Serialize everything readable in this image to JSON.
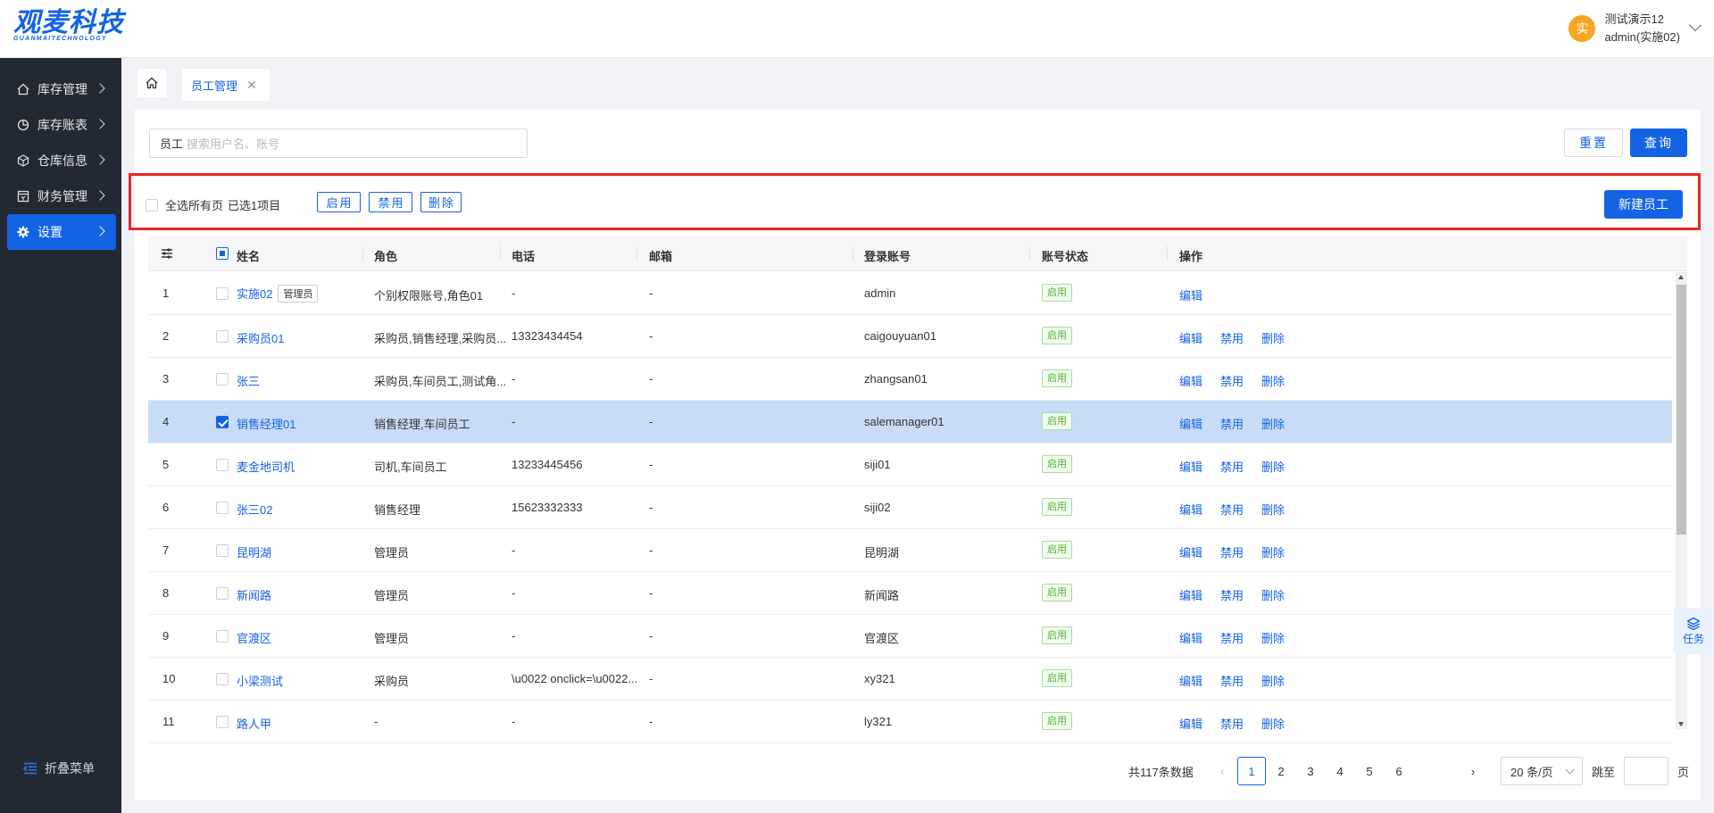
{
  "header": {
    "logo_main": "观麦科技",
    "logo_sub": "GUANMAITECHNOLOGY",
    "avatar_text": "实",
    "user_line1": "测试演示12",
    "user_line2": "admin(实施02)"
  },
  "sidebar": {
    "items": [
      {
        "label": "库存管理",
        "icon": "home-icon"
      },
      {
        "label": "库存账表",
        "icon": "pie-chart-icon"
      },
      {
        "label": "仓库信息",
        "icon": "cube-icon"
      },
      {
        "label": "财务管理",
        "icon": "finance-icon"
      },
      {
        "label": "设置",
        "icon": "gear-icon",
        "active": true
      }
    ],
    "collapse_label": "折叠菜单"
  },
  "tabs": {
    "active_label": "员工管理"
  },
  "search": {
    "label": "员工",
    "placeholder": "搜索用户名、账号",
    "reset_label": "重置",
    "query_label": "查询"
  },
  "actions": {
    "select_all_label": "全选所有页",
    "selected_text": "已选1项目",
    "enable_label": "启用",
    "disable_label": "禁用",
    "delete_label": "删除",
    "new_label": "新建员工"
  },
  "table": {
    "columns": [
      "姓名",
      "角色",
      "电话",
      "邮箱",
      "登录账号",
      "账号状态",
      "操作"
    ],
    "rows": [
      {
        "no": "1",
        "name": "实施02",
        "tag": "管理员",
        "role": "个别权限账号,角色01",
        "phone": "-",
        "email": "-",
        "account": "admin",
        "status": "启用",
        "checked": false,
        "ops": [
          "编辑"
        ]
      },
      {
        "no": "2",
        "name": "采购员01",
        "tag": "",
        "role": "采购员,销售经理,采购员...",
        "phone": "13323434454",
        "email": "-",
        "account": "caigouyuan01",
        "status": "启用",
        "checked": false,
        "ops": [
          "编辑",
          "禁用",
          "删除"
        ]
      },
      {
        "no": "3",
        "name": "张三",
        "tag": "",
        "role": "采购员,车间员工,测试角...",
        "phone": "-",
        "email": "-",
        "account": "zhangsan01",
        "status": "启用",
        "checked": false,
        "ops": [
          "编辑",
          "禁用",
          "删除"
        ]
      },
      {
        "no": "4",
        "name": "销售经理01",
        "tag": "",
        "role": "销售经理,车间员工",
        "phone": "-",
        "email": "-",
        "account": "salemanager01",
        "status": "启用",
        "checked": true,
        "ops": [
          "编辑",
          "禁用",
          "删除"
        ]
      },
      {
        "no": "5",
        "name": "麦金地司机",
        "tag": "",
        "role": "司机,车间员工",
        "phone": "13233445456",
        "email": "-",
        "account": "siji01",
        "status": "启用",
        "checked": false,
        "ops": [
          "编辑",
          "禁用",
          "删除"
        ]
      },
      {
        "no": "6",
        "name": "张三02",
        "tag": "",
        "role": "销售经理",
        "phone": "15623332333",
        "email": "-",
        "account": "siji02",
        "status": "启用",
        "checked": false,
        "ops": [
          "编辑",
          "禁用",
          "删除"
        ]
      },
      {
        "no": "7",
        "name": "昆明湖",
        "tag": "",
        "role": "管理员",
        "phone": "-",
        "email": "-",
        "account": "昆明湖",
        "status": "启用",
        "checked": false,
        "ops": [
          "编辑",
          "禁用",
          "删除"
        ]
      },
      {
        "no": "8",
        "name": "新闻路",
        "tag": "",
        "role": "管理员",
        "phone": "-",
        "email": "-",
        "account": "新闻路",
        "status": "启用",
        "checked": false,
        "ops": [
          "编辑",
          "禁用",
          "删除"
        ]
      },
      {
        "no": "9",
        "name": "官渡区",
        "tag": "",
        "role": "管理员",
        "phone": "-",
        "email": "-",
        "account": "官渡区",
        "status": "启用",
        "checked": false,
        "ops": [
          "编辑",
          "禁用",
          "删除"
        ]
      },
      {
        "no": "10",
        "name": "小梁测试",
        "tag": "",
        "role": "采购员",
        "phone": "\\u0022 onclick=\\u0022...",
        "email": "-",
        "account": "xy321",
        "status": "启用",
        "checked": false,
        "ops": [
          "编辑",
          "禁用",
          "删除"
        ]
      },
      {
        "no": "11",
        "name": "路人甲",
        "tag": "",
        "role": "-",
        "phone": "-",
        "email": "-",
        "account": "ly321",
        "status": "启用",
        "checked": false,
        "ops": [
          "编辑",
          "禁用",
          "删除"
        ]
      }
    ]
  },
  "pagination": {
    "total_text": "共117条数据",
    "pages": [
      "1",
      "2",
      "3",
      "4",
      "5",
      "6"
    ],
    "current": "1",
    "page_size": "20 条/页",
    "jump_label": "跳至",
    "page_suffix": "页"
  },
  "task": {
    "label": "任务"
  },
  "colors": {
    "primary": "#1463e4",
    "sidebar_bg": "#232934",
    "highlight_border": "#e6262b",
    "status_green": "#52b135",
    "selected_row": "#c8dcf8"
  }
}
